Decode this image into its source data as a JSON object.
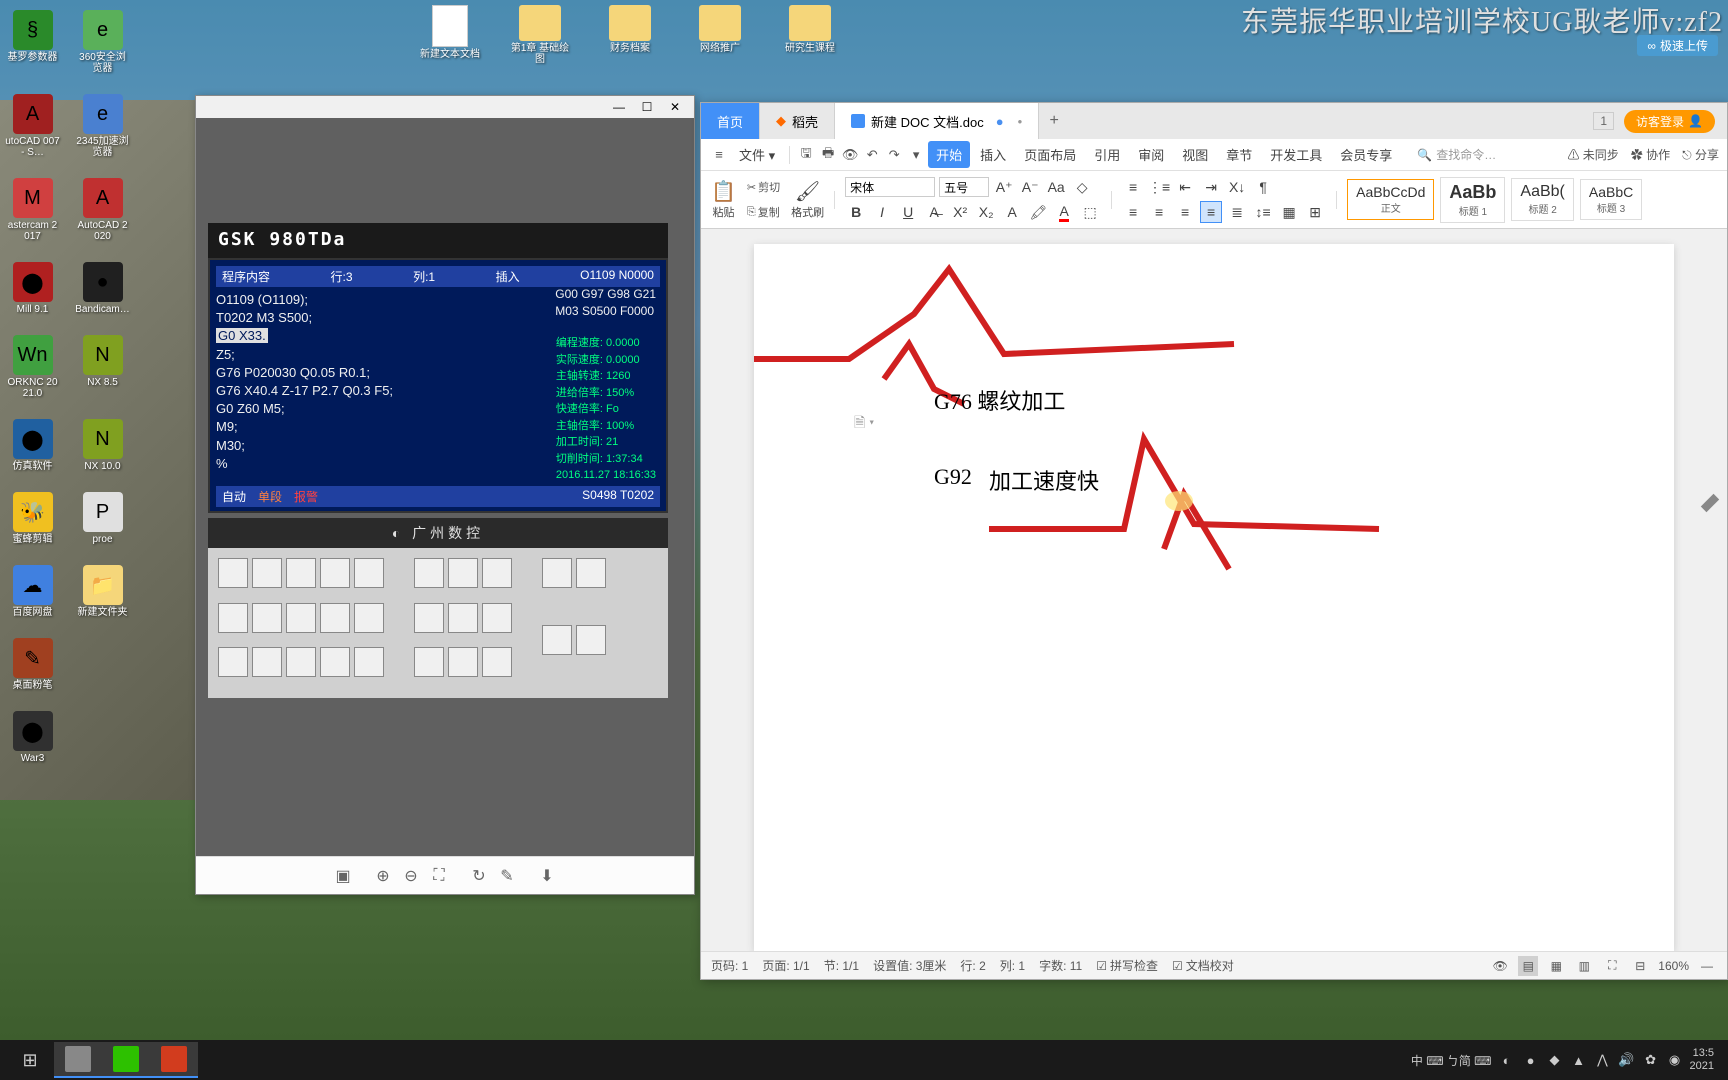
{
  "watermark": "东莞振华职业培训学校UG耿老师v:zf2",
  "upload_badge": "极速上传",
  "desktop_icons": {
    "col1": [
      "基罗参数器",
      "utoCAD 007 - S…",
      "astercam 2017",
      "Mill 9.1",
      "ORKNC 2021.0",
      "仿真软件",
      "蜜蜂剪辑",
      "百度网盘",
      "",
      "War3"
    ],
    "col2": [
      "360安全浏览器",
      "2345加速浏览器",
      "AutoCAD 2020",
      "Bandicam…",
      "NX 8.5",
      "NX 10.0",
      "proe",
      "新建文件夹",
      "",
      ""
    ],
    "top": [
      "新建文本文档",
      "第1章 基础绘图",
      "财务档案",
      "网络推广",
      "研究生课程"
    ]
  },
  "image_viewer": {
    "win_buttons": {
      "min": "—",
      "max": "☐",
      "close": "✕"
    },
    "cnc_logo": "GSK 980TDa",
    "cnc_header": {
      "left": "程序内容",
      "row": "行:3",
      "col": "列:1",
      "mode": "插入",
      "right": "O1109 N0000"
    },
    "cnc_code": [
      "O1109 (O1109);",
      "T0202 M3 S500;",
      "G0 X33.",
      "Z5;",
      "G76 P020030 Q0.05 R0.1;",
      "G76 X40.4 Z-17 P2.7 Q0.3 F5;",
      "G0 Z60 M5;",
      "M9;",
      "M30;",
      "%"
    ],
    "cnc_side_top": [
      "G00 G97 G98 G21",
      "M03 S0500 F0000"
    ],
    "cnc_status": [
      "编程速度:    0.0000",
      "实际速度:    0.0000",
      "主轴转速:      1260",
      "进给倍率:      150%",
      "快速倍率:        Fo",
      "主轴倍率:      100%",
      "加工时间:        21",
      "切削时间:   1:37:34",
      "2016.11.27 18:16:33"
    ],
    "cnc_footer": {
      "auto": "自动",
      "single": "单段",
      "alarm": "报警",
      "right": "S0498 T0202"
    },
    "cnc_panel_label": "◐ 广州数控",
    "toolbar_icons": [
      "screen-icon",
      "zoom-in-icon",
      "zoom-out-icon",
      "fit-icon",
      "rotate-icon",
      "edit-icon",
      "download-icon"
    ]
  },
  "wps": {
    "tabs": {
      "home": "首页",
      "daohangke": "稻壳",
      "doc_icon_label": "W",
      "doc": "新建 DOC 文档.doc",
      "add": "+",
      "badge": "1",
      "login": "访客登录"
    },
    "menu": {
      "file": "文件",
      "items": [
        "开始",
        "插入",
        "页面布局",
        "引用",
        "审阅",
        "视图",
        "章节",
        "开发工具",
        "会员专享"
      ],
      "search_placeholder": "查找命令…",
      "unsync": "未同步",
      "coop": "协作",
      "share": "分享"
    },
    "ribbon": {
      "paste": "粘贴",
      "cut": "剪切",
      "copy": "复制",
      "format_brush": "格式刷",
      "font": "宋体",
      "font_size": "五号",
      "styles": [
        {
          "preview": "AaBbCcDd",
          "name": "正文"
        },
        {
          "preview": "AaBb",
          "name": "标题 1"
        },
        {
          "preview": "AaBb(",
          "name": "标题 2"
        },
        {
          "preview": "AaBbC",
          "name": "标题 3"
        }
      ]
    },
    "document": {
      "line1": "G76 螺纹加工",
      "line2_a": "G92",
      "line2_b": "加工速度快"
    },
    "statusbar": {
      "page_num": "页码: 1",
      "page": "页面: 1/1",
      "section": "节: 1/1",
      "setting": "设置值: 3厘米",
      "row": "行: 2",
      "col": "列: 1",
      "chars": "字数: 11",
      "spell": "拼写检查",
      "proof": "文档校对",
      "zoom": "160%"
    }
  },
  "taskbar": {
    "apps": [
      "start-icon",
      "app1",
      "wechat-icon",
      "wps-icon"
    ],
    "tray_text": "中 ⌨ ㄅ简 ⌨",
    "time": "13:5",
    "date": "2021"
  }
}
